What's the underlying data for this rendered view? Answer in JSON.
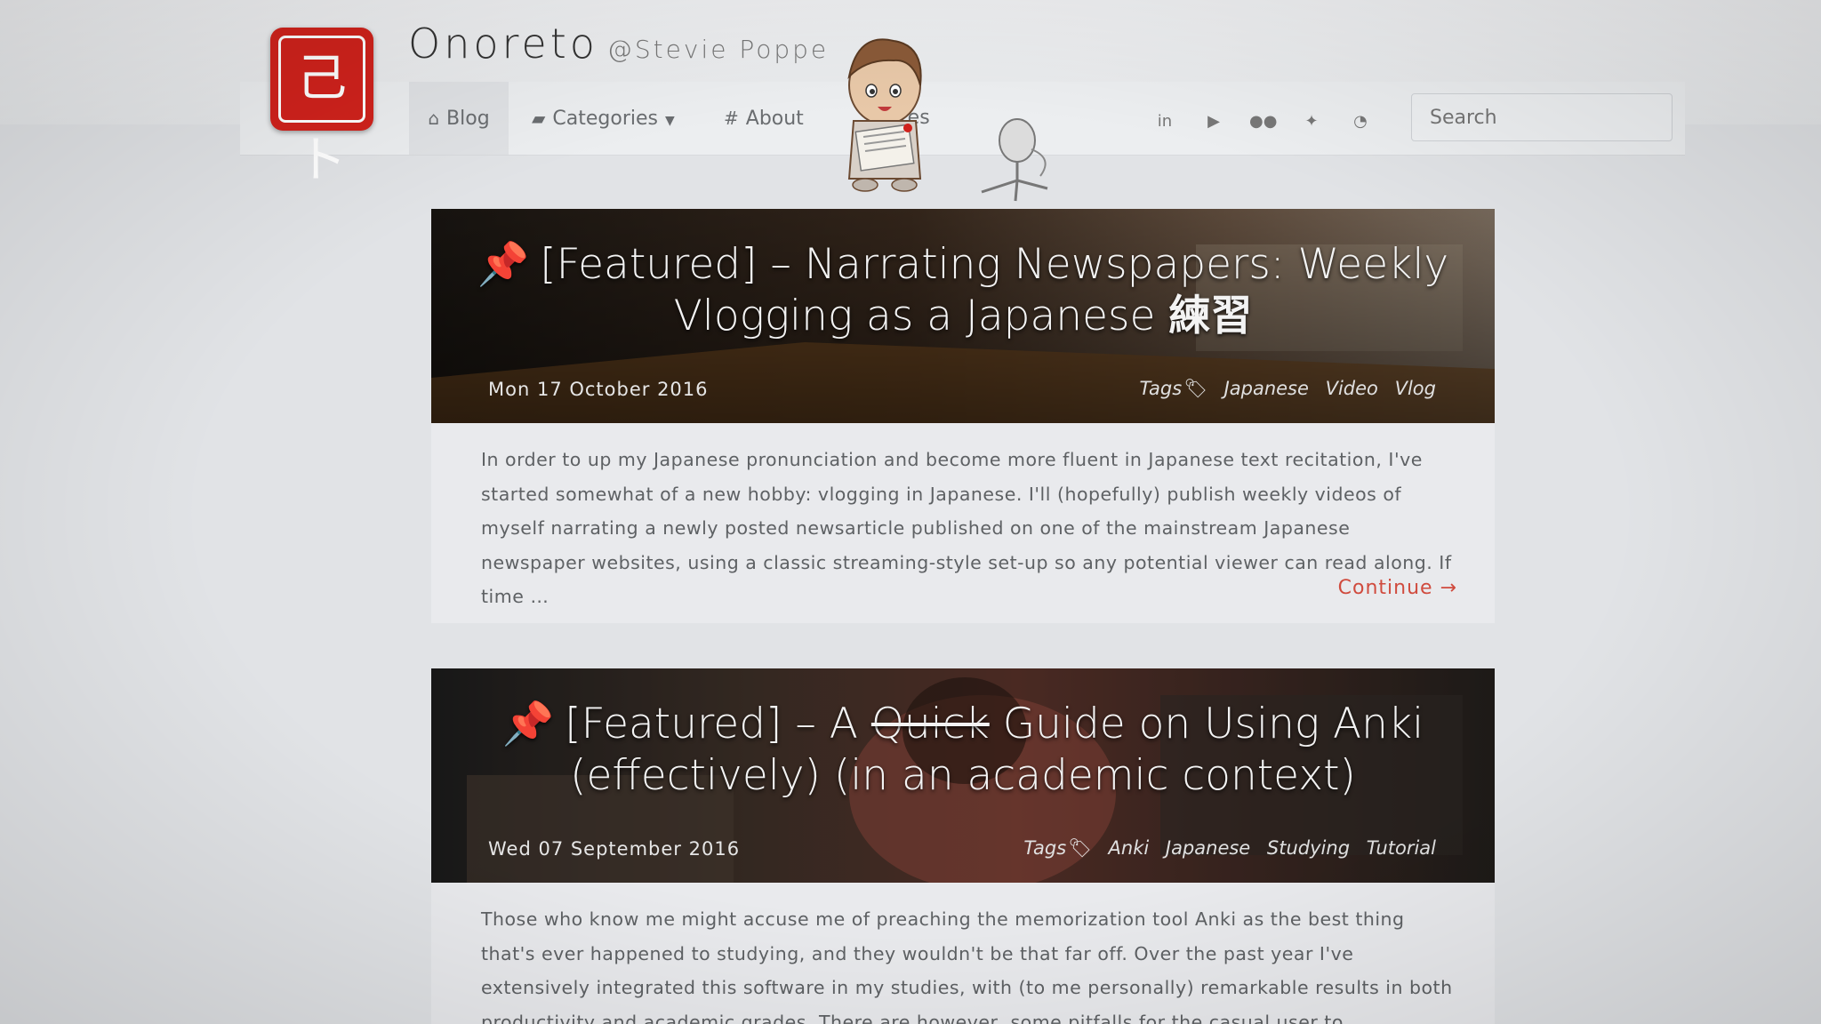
{
  "brand": {
    "logo_text": "己ト",
    "name": "Onoreto",
    "handle": "@Stevie Poppe"
  },
  "nav": {
    "blog": "Blog",
    "categories": "Categories",
    "about": "About",
    "resources_partial": "rces"
  },
  "social": [
    "linkedin-icon",
    "youtube-icon",
    "flickr-icon",
    "twitter-icon",
    "rss-icon"
  ],
  "search": {
    "placeholder": "Search"
  },
  "posts": [
    {
      "title_prefix": "[Featured] – Narrating Newspapers: Weekly Vlogging as a Japanese ",
      "title_kanji": "練習",
      "date": "Mon 17 October 2016",
      "tags_label": "Tags",
      "tags": [
        "Japanese",
        "Video",
        "Vlog"
      ],
      "excerpt": "In order to up my Japanese pronunciation and become more fluent in Japanese text recitation, I've started somewhat of a new hobby: vlogging in Japanese. I'll (hopefully) publish weekly videos of myself narrating a newly posted newsarticle published on one of the mainstream Japanese newspaper websites, using a classic streaming-style set-up so any potential viewer can read along. If time …",
      "continue": "Continue →"
    },
    {
      "title_before": "[Featured] – A ",
      "title_strike": "Quick",
      "title_after": " Guide on Using Anki (effectively) (in an academic context)",
      "date": "Wed 07 September 2016",
      "tags_label": "Tags",
      "tags": [
        "Anki",
        "Japanese",
        "Studying",
        "Tutorial"
      ],
      "excerpt": "Those who know me might accuse me of preaching the memorization tool Anki as the best thing that's ever happened to studying, and they wouldn't be that far off. Over the past year I've extensively integrated this software in my studies, with (to me personally) remarkable results in both productivity and academic grades. There are however, some pitfalls for the casual user to"
    }
  ],
  "colors": {
    "logo_red": "#d0221c",
    "continue_red": "#d04b3e",
    "background": "#e1e3e6"
  }
}
